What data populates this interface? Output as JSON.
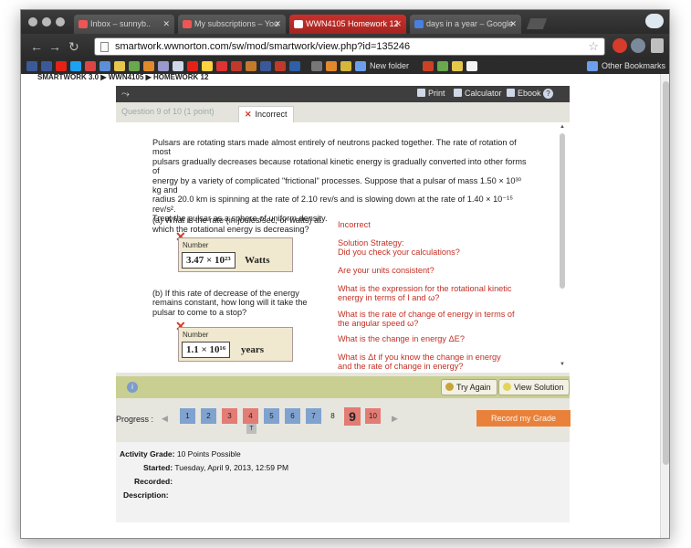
{
  "browser": {
    "tabs": [
      {
        "label": "Inbox – sunnyb..",
        "active": false,
        "favicon_color": "#e34133"
      },
      {
        "label": "My subscriptions – You",
        "active": false,
        "favicon_color": "#e62117"
      },
      {
        "label": "WWN4105 Homework 12",
        "active": true,
        "favicon_color": "#ffffff"
      },
      {
        "label": "days in a year – Google",
        "active": false,
        "favicon_color": "#4a7fe0"
      }
    ],
    "url": "smartwork.wwnorton.com/sw/mod/smartwork/view.php?id=135246",
    "bookmarks": {
      "new_folder": "New folder",
      "other": "Other Bookmarks"
    }
  },
  "page": {
    "breadcrumb": "SMARTWORK 3.0 ▶ WWN4105 ▶ HOMEWORK 12"
  },
  "module": {
    "toolbar": {
      "print": "Print",
      "calculator": "Calculator",
      "ebook": "Ebook"
    },
    "question_tab": "Question 9 of 10 (1 point)",
    "status_tab": "Incorrect",
    "problem_lines": [
      "Pulsars are rotating stars made almost entirely of neutrons packed together. The rate of rotation of most",
      "pulsars gradually decreases because rotational kinetic energy is gradually converted into other forms of",
      "energy by a variety of complicated \"frictional\" processes. Suppose that a pulsar of mass 1.50 × 10³⁰ kg and",
      "radius 20.0 km is spinning at the rate of 2.10 rev/s and is slowing down at the rate of 1.40 × 10⁻¹⁵ rev/s².",
      "Treat the pulsar as a sphere of uniform density."
    ],
    "part_a": {
      "question_lines": [
        "(a) What is the rate (in joules/sec, or watts) at",
        "which the rotational energy is decreasing?"
      ],
      "label": "Number",
      "value": "3.47 × 10²³",
      "unit": "Watts"
    },
    "part_b": {
      "question_lines": [
        "(b) If this rate of decrease of the energy",
        "remains constant, how long will it take the",
        "pulsar to come to a stop?"
      ],
      "label": "Number",
      "value": "1.1 × 10¹⁶",
      "unit": "years"
    },
    "feedback": {
      "status": "Incorrect",
      "strategy_title": "Solution Strategy:",
      "items": [
        "Did you check your calculations?",
        "Are your units consistent?",
        "What is the expression for the rotational kinetic",
        "energy in terms of I and ω?",
        "What is the rate of change of energy in terms of",
        "the angular speed ω?",
        "What is the change in energy ΔE?",
        "What is Δt if you know the change in energy",
        "and the rate of change in energy?"
      ]
    },
    "actions": {
      "try_again": "Try Again",
      "view_solution": "View Solution"
    },
    "progress": {
      "label": "Progress :",
      "questions": [
        {
          "num": "1",
          "state": "blue"
        },
        {
          "num": "2",
          "state": "blue"
        },
        {
          "num": "3",
          "state": "red"
        },
        {
          "num": "4",
          "state": "red"
        },
        {
          "num": "5",
          "state": "blue"
        },
        {
          "num": "6",
          "state": "blue"
        },
        {
          "num": "7",
          "state": "blue"
        },
        {
          "num": "8",
          "state": "plain"
        },
        {
          "num": "9",
          "state": "current"
        },
        {
          "num": "10",
          "state": "red"
        }
      ],
      "badge": "T",
      "record_grade": "Record my Grade"
    },
    "grade": {
      "activity_grade_label": "Activity Grade:",
      "activity_grade_value": "10 Points Possible",
      "started_label": "Started:",
      "started_value": "Tuesday, April 9, 2013, 12:59 PM",
      "recorded_label": "Recorded:",
      "recorded_value": "",
      "description_label": "Description:",
      "description_value": ""
    }
  }
}
